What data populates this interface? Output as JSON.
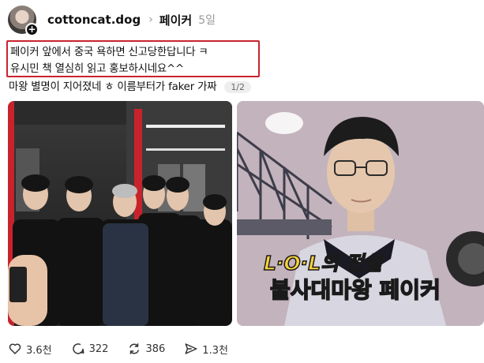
{
  "post": {
    "username": "cottoncat.dog",
    "topic": "페이커",
    "time": "5일",
    "highlight_lines": [
      "페이커 앞에서 중국 욕하면 신고당한답니다 ㅋ",
      "유시민 책 열심히 읽고 홍보하시네요^^"
    ],
    "body_line": "마왕 별명이 지어졌네 ㅎ 이름부터가 faker 가짜",
    "image_counter": "1/2",
    "image2_caption_top": "L·O·L의 전설",
    "image2_caption_bottom": "불사대마왕 페이커"
  },
  "actions": {
    "likes": "3.6천",
    "comments": "322",
    "reposts": "386",
    "shares": "1.3천"
  },
  "colors": {
    "highlight_border": "#c9242f",
    "caption_fill": "#f7d33a",
    "caption_stroke": "#1a1a1a"
  }
}
